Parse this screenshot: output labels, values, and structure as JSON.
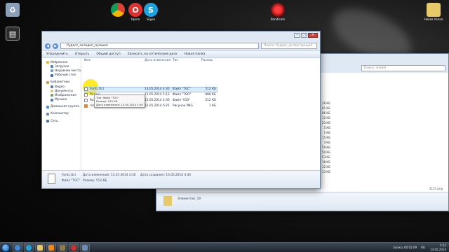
{
  "desktop": {
    "icons": [
      {
        "name": "recycle-bin-icon",
        "label": ""
      },
      {
        "name": "media-icon",
        "label": ""
      },
      {
        "name": "chrome-icon",
        "label": ""
      },
      {
        "name": "opera-icon",
        "label": "Opera"
      },
      {
        "name": "skype-icon",
        "label": "Skype"
      },
      {
        "name": "bandicam-icon",
        "label": "Bandicam"
      },
      {
        "name": "new-folder-icon",
        "label": "Новая папка"
      }
    ]
  },
  "explorer_front": {
    "address": "Рудасс_складкп_пупшоп",
    "search_placeholder": "Поиск: Рудасс_склад прощоп",
    "toolbar": [
      "Упорядочить",
      "Открыть",
      "Общий доступ",
      "Записать на оптический диск",
      "Новая папка"
    ],
    "nav": {
      "favorites": "Избранное",
      "favorites_items": [
        "Загрузки",
        "Недавние места",
        "Рабочий стол"
      ],
      "libraries": "Библиотеки",
      "libraries_items": [
        "Видео",
        "Документы",
        "Изображения",
        "Музыка"
      ],
      "homegroup": "Домашняя группа",
      "computer": "Компьютер",
      "network": "Сеть"
    },
    "columns": [
      "Имя",
      "Дата изменения",
      "Тип",
      "Размер"
    ],
    "files": [
      {
        "name": "Fonts.ttcl",
        "date": "13.05.2014 4:30",
        "type": "Файл \"TGC\"",
        "size": "512 КБ"
      },
      {
        "name": "Rudasj",
        "date": "13.05.2014 5:13",
        "type": "Файл \"TGD\"",
        "size": "988 КБ"
      },
      {
        "name": "Rulejl",
        "date": "13.05.2014 4:30",
        "type": "Файл \"IGD\"",
        "size": "512 КБ"
      },
      {
        "name": "rimworlde",
        "date": "13.05.2014 6:25",
        "type": "Рисунок PNG",
        "size": "1 КБ"
      }
    ],
    "tooltip": [
      "Тип: Файл \"TGC\"",
      "Размер: 512 КБ",
      "Дата изменения: 13.05.2014 4:30"
    ],
    "details": {
      "name": "Fonts.ttcl",
      "type": "Файл \"TGC\"",
      "modified_label": "Дата изменения: 13.05.2014 4:30",
      "size_label": "Размер: 512 КБ",
      "created_label": "Дата создания: 13.05.2014 4:30"
    }
  },
  "explorer_back": {
    "search_placeholder": "Поиск: model",
    "sizes": [
      "26 КБ",
      "61 КБ",
      "86 КБ",
      "12 КБ",
      "23 КБ",
      "5 КБ",
      "1 КБ",
      "15 КБ",
      "4 КБ",
      "59 КБ",
      "50 КБ",
      "53 КБ",
      "18 КБ",
      "12 КБ",
      "13 КБ"
    ],
    "file_hint": "1157.png",
    "status": "Элементов: 19"
  },
  "taskbar": {
    "status_text": "Запись 00:01:09",
    "time": "4:52",
    "date": "13.05.2014",
    "lang": "RU"
  },
  "colors": {
    "window_frame": "#dfe8f3",
    "selection": "#cde3f7",
    "highlight_circle": "#ffe600"
  }
}
